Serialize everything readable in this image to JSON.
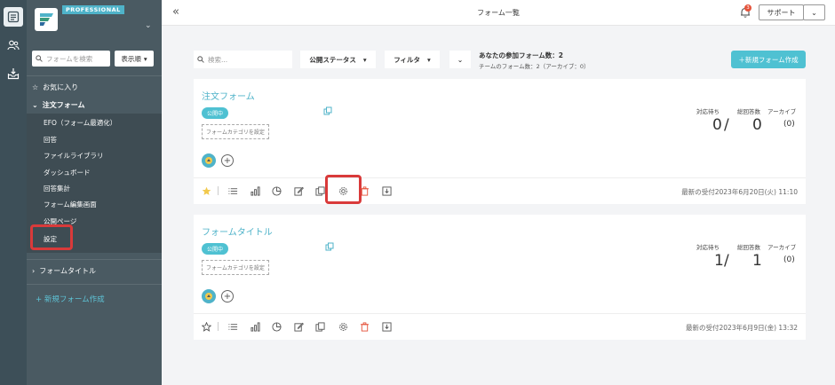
{
  "topbar": {
    "title": "フォーム一覧",
    "notification_count": "3",
    "support_label": "サポート"
  },
  "sidebar": {
    "badge": "PROFESSIONAL",
    "search_placeholder": "フォームを検索",
    "sort_label": "表示順",
    "favorites_label": "お気に入り",
    "expanded_form": "注文フォーム",
    "sub_items": [
      "EFO（フォーム最適化）",
      "回答",
      "ファイルライブラリ",
      "ダッシュボード",
      "回答集計",
      "フォーム編集画面",
      "公開ページ",
      "設定"
    ],
    "collapsed_form": "フォームタイトル",
    "new_form_label": "新規フォーム作成"
  },
  "filters": {
    "search_placeholder": "検索...",
    "status_label": "公開ステータス",
    "filter_label": "フィルタ",
    "participation": "あなたの参加フォーム数：2",
    "team_count": "チームのフォーム数：2（アーカイブ：0）",
    "create_label": "＋新規フォーム作成"
  },
  "cards": [
    {
      "title": "注文フォーム",
      "status": "公開中",
      "category_label": "フォームカテゴリを設定",
      "stat_headers": [
        "対応待ち",
        "総回答数",
        "アーカイブ"
      ],
      "pending": "0",
      "total": "0",
      "archive": "(0)",
      "last_received": "最新の受付2023年6月20日(火) 11:10",
      "favorited": true
    },
    {
      "title": "フォームタイトル",
      "status": "公開中",
      "category_label": "フォームカテゴリを設定",
      "stat_headers": [
        "対応待ち",
        "総回答数",
        "アーカイブ"
      ],
      "pending": "1",
      "total": "1",
      "archive": "(0)",
      "last_received": "最新の受付2023年6月9日(金) 13:32",
      "favorited": false
    }
  ],
  "colors": {
    "accent": "#4fc1d2",
    "highlight": "#d93a3a",
    "sidebar": "#4a5a62",
    "rail": "#3d4f58"
  }
}
